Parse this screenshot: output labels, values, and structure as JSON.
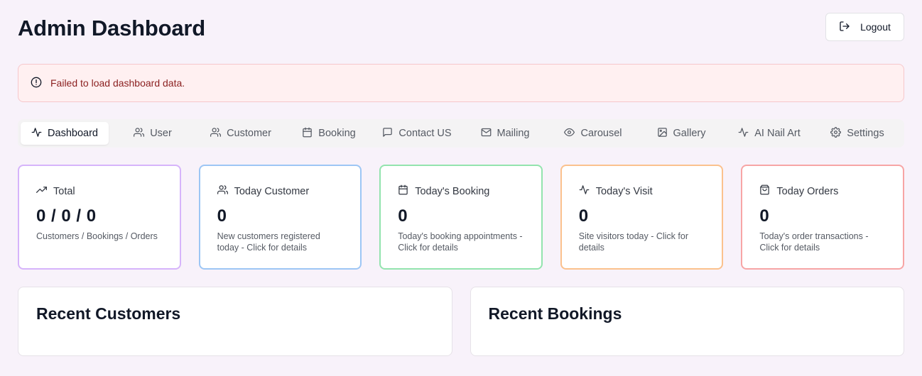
{
  "header": {
    "title": "Admin Dashboard",
    "logout_label": "Logout"
  },
  "alert": {
    "message": "Failed to load dashboard data."
  },
  "tabs": [
    {
      "label": "Dashboard",
      "icon": "activity-icon"
    },
    {
      "label": "User",
      "icon": "users-icon"
    },
    {
      "label": "Customer",
      "icon": "users-icon"
    },
    {
      "label": "Booking",
      "icon": "calendar-icon"
    },
    {
      "label": "Contact US",
      "icon": "message-square-icon"
    },
    {
      "label": "Mailing",
      "icon": "mail-icon"
    },
    {
      "label": "Carousel",
      "icon": "eye-icon"
    },
    {
      "label": "Gallery",
      "icon": "image-icon"
    },
    {
      "label": "AI Nail Art",
      "icon": "activity-icon"
    },
    {
      "label": "Settings",
      "icon": "gear-icon"
    }
  ],
  "active_tab": "Dashboard",
  "cards": [
    {
      "title": "Total",
      "value": "0 / 0 / 0",
      "desc": "Customers / Bookings / Orders",
      "icon": "trending-up-icon",
      "border": "#d6b4fb"
    },
    {
      "title": "Today Customer",
      "value": "0",
      "desc": "New customers registered today - Click for details",
      "icon": "users-icon",
      "border": "#9dc6f5"
    },
    {
      "title": "Today's Booking",
      "value": "0",
      "desc": "Today's booking appointments - Click for details",
      "icon": "calendar-icon",
      "border": "#93e4ae"
    },
    {
      "title": "Today's Visit",
      "value": "0",
      "desc": "Site visitors today - Click for details",
      "icon": "activity-icon",
      "border": "#fbc18d"
    },
    {
      "title": "Today Orders",
      "value": "0",
      "desc": "Today's order transactions - Click for details",
      "icon": "shopping-bag-icon",
      "border": "#f7a5a5"
    }
  ],
  "panels": {
    "recent_customers_title": "Recent Customers",
    "recent_bookings_title": "Recent Bookings"
  }
}
